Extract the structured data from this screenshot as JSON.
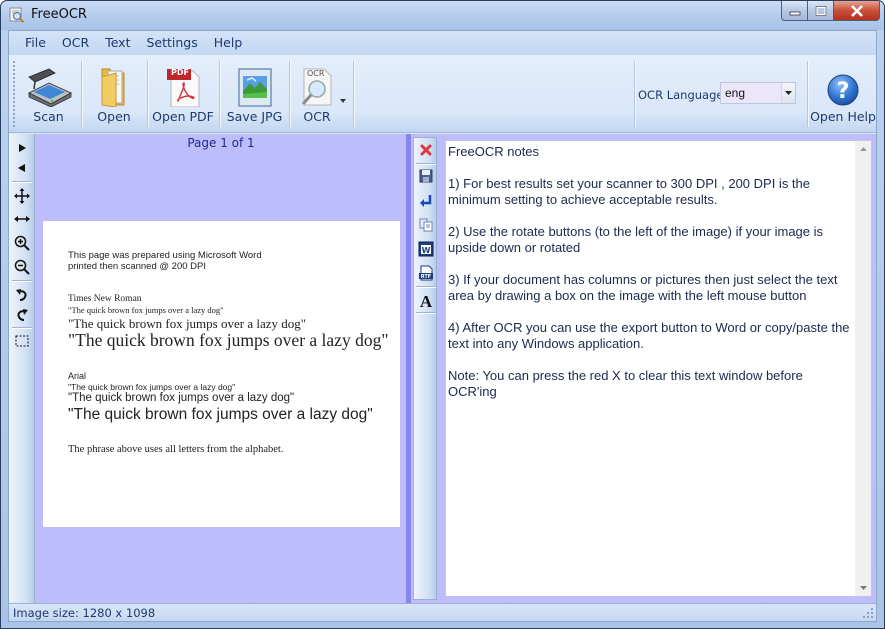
{
  "window": {
    "title": "FreeOCR",
    "controls": [
      "minimize",
      "maximize",
      "close"
    ]
  },
  "menu": [
    "File",
    "OCR",
    "Text",
    "Settings",
    "Help"
  ],
  "toolbar": {
    "scan": "Scan",
    "open": "Open",
    "open_pdf": "Open PDF",
    "save_jpg": "Save JPG",
    "ocr": "OCR",
    "ocr_icon_text": "OCR",
    "pdf_icon_text": "PDF",
    "ocr_language_label": "OCR Language:",
    "ocr_language_value": "eng",
    "open_help": "Open Help"
  },
  "image_pane": {
    "page_label": "Page 1 of 1",
    "tools": [
      "next-page",
      "previous-page",
      "pan",
      "fit-width",
      "zoom-in",
      "zoom-out",
      "rotate-left",
      "rotate-right",
      "select-area"
    ],
    "scanned_page": {
      "intro_line1": "This page was prepared using Microsoft Word",
      "intro_line2": "printed then scanned @ 200 DPI",
      "tnr_heading": "Times New Roman",
      "tnr_small": "\"The quick brown fox jumps over a lazy dog\"",
      "tnr_medium": "\"The quick brown fox jumps over a lazy dog\"",
      "tnr_large": "\"The quick brown fox jumps over a lazy dog\"",
      "arial_heading": "Arial",
      "arial_small": "\"The quick brown fox jumps over a lazy dog\"",
      "arial_medium": "\"The quick brown fox  jumps over a lazy dog\"",
      "arial_large": "\"The quick brown fox jumps over a lazy dog\"",
      "footer": "The phrase above uses all letters from the alphabet."
    }
  },
  "text_pane": {
    "tools": [
      "clear-text",
      "save-text",
      "word-wrap",
      "copy",
      "export-word",
      "export-rtf",
      "font"
    ],
    "rtf_icon_text": "RTF",
    "word_icon_text": "W",
    "content": "FreeOCR notes\n\n1) For best results set your scanner to 300 DPI , 200 DPI is the minimum setting to achieve acceptable results.\n\n2) Use the rotate buttons (to the left of the image) if your image is upside down or rotated\n\n3) If your document has columns or pictures then just select the text area by drawing a box on the image with the left mouse button\n\n4) After OCR you can use the export button to Word or copy/paste the text into any Windows application.\n\nNote: You can press the red X to clear this text window before OCR'ing"
  },
  "status": {
    "image_size": "Image size:  1280 x  1098"
  },
  "colors": {
    "image_background": "#bdbdfb",
    "splitter": "#8585ee",
    "clear_icon": "#e0383a",
    "help_icon": "#2d6fd0"
  }
}
